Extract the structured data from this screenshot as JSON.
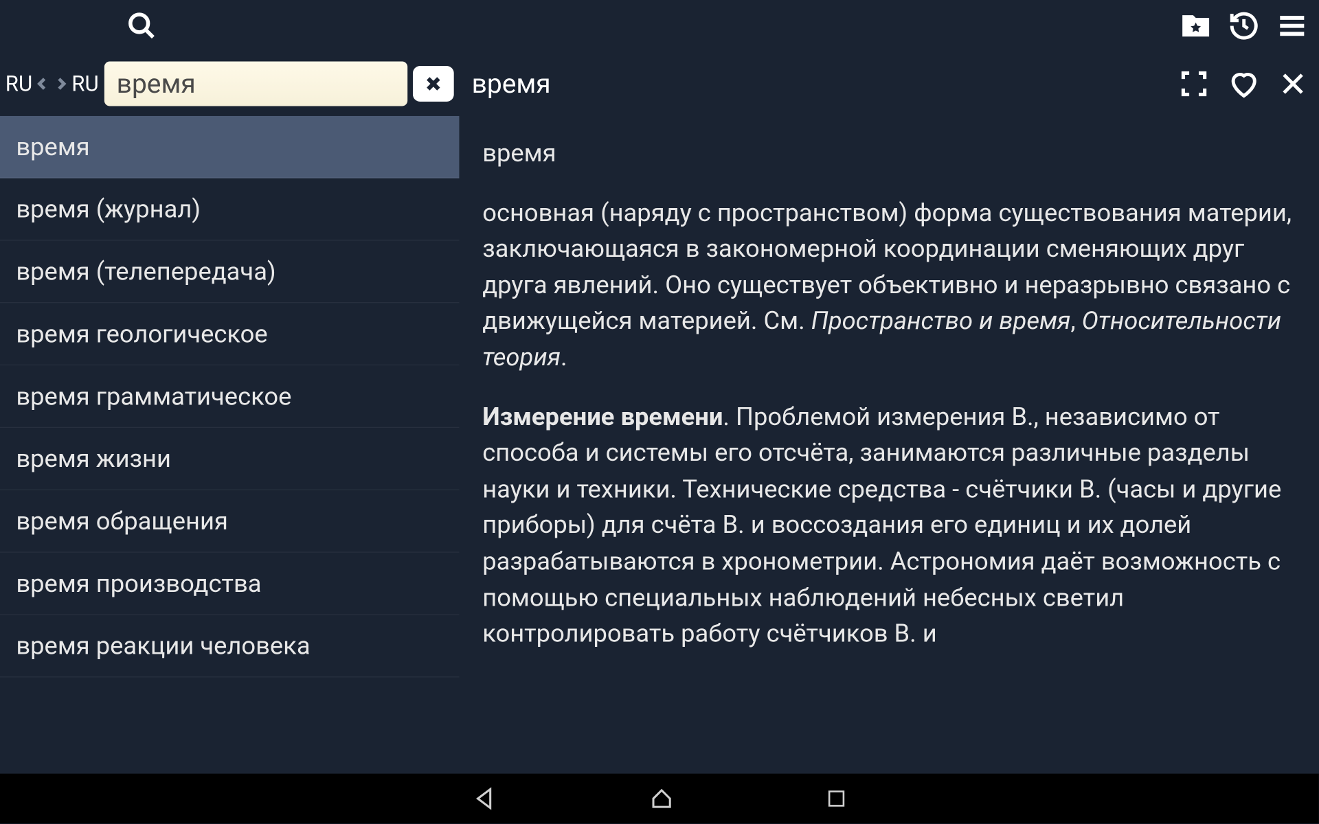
{
  "toolbar": {
    "lang_from": "RU",
    "lang_to": "RU"
  },
  "search": {
    "value": "время"
  },
  "suggestions": [
    "время",
    "время (журнал)",
    "время (телепередача)",
    "время геологическое",
    "время грамматическое",
    "время жизни",
    "время обращения",
    "время производства",
    "время реакции человека"
  ],
  "article": {
    "title": "время",
    "headword": "время",
    "para1_a": "основная (наряду с пространством) форма существования материи, заключающаяся в закономерной координации сменяющих друг друга явлений. Оно существует объективно и неразрывно связано с движущейся материей. См. ",
    "para1_b": "Пространство и время",
    "para1_c": ", ",
    "para1_d": "Относительности теория",
    "para1_e": ".",
    "para2_a": "Измерение времени",
    "para2_b": ". Проблемой измерения В., независимо от способа и системы его отсчёта, занимаются различные разделы науки и техники. Технические средства - счётчики В. (часы и другие приборы) для счёта В. и воссоздания его единиц и их долей разрабатываются в хронометрии. Астрономия даёт возможность с помощью специальных наблюдений небесных светил контролировать работу счётчиков В. и"
  }
}
